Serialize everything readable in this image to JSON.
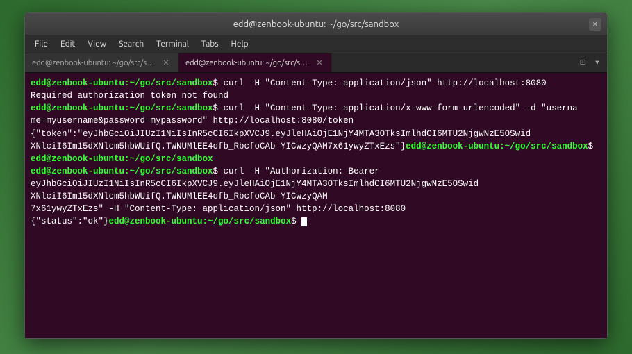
{
  "window": {
    "title": "edd@zenbook-ubuntu: ~/go/src/sandbox",
    "close_label": "✕"
  },
  "menubar": {
    "items": [
      "File",
      "Edit",
      "View",
      "Search",
      "Terminal",
      "Tabs",
      "Help"
    ]
  },
  "tabs": [
    {
      "label": "edd@zenbook-ubuntu: ~/go/src/sandbox",
      "active": false
    },
    {
      "label": "edd@zenbook-ubuntu: ~/go/src/sandbox",
      "active": true
    }
  ],
  "terminal": {
    "lines": [
      {
        "type": "command",
        "prompt": "edd@zenbook-ubuntu:~/go/src/sandbox",
        "cmd": "$ curl -H \"Content-Type: application/json\" http://localhost:8080"
      },
      {
        "type": "output",
        "text": "Required authorization token not found"
      },
      {
        "type": "command",
        "prompt": "edd@zenbook-ubuntu:~/go/src/sandbox",
        "cmd": "$ curl -H \"Content-Type: application/x-www-form-urlencoded\" -d \"username=myusername&password=mypassword\" http://localhost:8080/token"
      },
      {
        "type": "output",
        "text": "{\"token\":\"eyJhbGciOiJIUzI1NiIsInR5cCI6IkpXVCJ9.eyJleHAiOjE1NjY4MTA3OTksImlhdCI6MTU2NjgwNzE5OSwid"
      },
      {
        "type": "output_cont",
        "text": "XNlciI6Im15dXNlcm5hbWUifQ.TWNUMlEE4ofb_RbcfoCAb YICwzyQAM7x61ywyZTxEzs\"}"
      },
      {
        "type": "prompt_only",
        "prompt": "edd@zenbook-ubuntu:~/go/src/sandbox",
        "cmd": "$"
      },
      {
        "type": "empty",
        "text": ""
      },
      {
        "type": "command",
        "prompt": "edd@zenbook-ubuntu:~/go/src/sandbox",
        "cmd": "$ curl -H \"Authorization: Bearer eyJhbGciOiJIUzI1NiIsInR5cCI6IkpXVCJ9.eyJleHAiOjE1NjY4MTA3OTksImlhdCI6MTU2NjgwNzE5OSwid XNlciI6Im15dXNlcm5hbWUifQ.TWNUMlEE4ofb_RbcfoCAb YICwzyQAM7x61ywyZTxEzs\" -H \"Content-Type: application/json\" http://localhost:8080"
      },
      {
        "type": "output",
        "text": "{\"status\":\"ok\"}"
      },
      {
        "type": "prompt_cursor",
        "prompt": "edd@zenbook-ubuntu:~/go/src/sandbox",
        "cmd": "$"
      }
    ]
  }
}
